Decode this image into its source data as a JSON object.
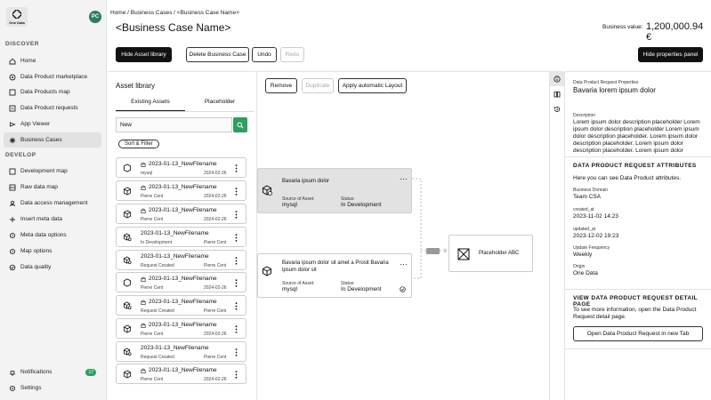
{
  "sidebar": {
    "logo_text": "One Data",
    "avatar_initials": "PC",
    "discover_label": "DISCOVER",
    "develop_label": "DEVELOP",
    "discover_items": [
      {
        "label": "Home",
        "icon": "home-icon"
      },
      {
        "label": "Data Product marketplace",
        "icon": "marketplace-icon"
      },
      {
        "label": "Data Products map",
        "icon": "map-icon"
      },
      {
        "label": "Data Product requests",
        "icon": "requests-icon"
      },
      {
        "label": "App Viewer",
        "icon": "app-viewer-icon"
      },
      {
        "label": "Business Cases",
        "icon": "business-cases-icon",
        "active": true
      }
    ],
    "develop_items": [
      {
        "label": "Development map",
        "icon": "development-map-icon"
      },
      {
        "label": "Raw data map",
        "icon": "raw-data-map-icon"
      },
      {
        "label": "Data access management",
        "icon": "access-icon"
      },
      {
        "label": "Insert meta data",
        "icon": "insert-meta-icon"
      },
      {
        "label": "Meta data options",
        "icon": "meta-options-icon"
      },
      {
        "label": "Map options",
        "icon": "map-options-icon"
      },
      {
        "label": "Data quality",
        "icon": "quality-icon"
      }
    ],
    "notifications_label": "Notifications",
    "notifications_count": "17",
    "settings_label": "Settings"
  },
  "header": {
    "breadcrumb": "Home / Business Cases / <Business Case Name>",
    "title": "<Business Case Name>",
    "business_value_label": "Business value:",
    "business_value": "1,200,000.94 €"
  },
  "toolbar": {
    "hide_asset_library": "Hide Asset library",
    "delete_business_case": "Delete Business Case",
    "undo": "Undo",
    "redo": "Redo",
    "hide_properties_panel": "Hide properties panel"
  },
  "asset_library": {
    "title": "Asset library",
    "tabs": [
      "Existing Assets",
      "Placeholder"
    ],
    "search_value": "New",
    "sort_filter": "Sort & Filter",
    "items": [
      {
        "name": "2023-01-13_NewFilename",
        "sub": "mysql",
        "right": "2024-02-26",
        "lock": true,
        "icon": "hexagon-icon"
      },
      {
        "name": "2023-01-13_NewFilename",
        "sub": "Pierre Cent",
        "right": "2024-02-26",
        "lock": true,
        "icon": "cube-icon"
      },
      {
        "name": "2023-01-13_NewFilename",
        "sub": "Pierre Cent",
        "right": "2024-02-26",
        "lock": true,
        "icon": "cube-icon"
      },
      {
        "name": "2023-01-13_NewFilename",
        "sub": "In Development",
        "right": "Pierre Cent",
        "lock": false,
        "icon": "data-product-icon"
      },
      {
        "name": "2023-01-13_NewFilename",
        "sub": "Request Created",
        "right": "Pierre Cent",
        "lock": false,
        "icon": "data-product-icon"
      },
      {
        "name": "2023-01-13_NewFilename",
        "sub": "Pierre Cent",
        "right": "2024-02-26",
        "lock": true,
        "icon": "hexagon-icon"
      },
      {
        "name": "2023-01-13_NewFilename",
        "sub": "Request Created",
        "right": "Pierre Cent",
        "lock": true,
        "icon": "data-product-icon"
      },
      {
        "name": "2023-01-13_NewFilename",
        "sub": "Pierre Cent",
        "right": "2024-02-26",
        "lock": true,
        "icon": "cube-icon"
      },
      {
        "name": "2023-01-13_NewFilename",
        "sub": "Request Created",
        "right": "Pierre Cent",
        "lock": false,
        "icon": "data-product-icon"
      },
      {
        "name": "2023-01-13_NewFilename",
        "sub": "Pierre Cent",
        "right": "2024-02-26",
        "lock": true,
        "icon": "cube-icon"
      }
    ]
  },
  "canvas": {
    "remove": "Remove",
    "duplicate": "Duplicate",
    "apply_layout": "Apply automatic Layout",
    "node1": {
      "title": "Bavaria ipsum dolor",
      "source_label": "Source of Asset:",
      "source": "mysql",
      "status_label": "Status:",
      "status": "In Development"
    },
    "node2": {
      "title": "Bavaria ipsum dolor sit amet a Prosit Bavaria ipsum dolor sit",
      "source_label": "Source of Asset:",
      "source": "mysql",
      "status_label": "Status:",
      "status": "In Development"
    },
    "node3": {
      "title": "Placeholder ABC"
    }
  },
  "properties": {
    "type_label": "Data Product Request Properties",
    "name": "Bavaria lorem ipsum dolor",
    "description_label": "Description",
    "description": "Lorem ipsum dolor description placeholder Lorem ipsum dolor description placeholder Lorem ipsum dolor description placeholder. Lorem ipsum dolor description placeholder. Lorem ipsum dolor description placeholder. Lorem ipsum dolor",
    "attributes_heading": "DATA PRODUCT REQUEST ATTRIBUTES",
    "attributes_intro": "Here you can see Data Product attributes.",
    "attributes": [
      {
        "label": "Business Domain",
        "value": "Team CSA"
      },
      {
        "label": "created_at",
        "value": "2023-11-02 14:23"
      },
      {
        "label": "updated_at",
        "value": "2023-12-02 19:23"
      },
      {
        "label": "Update Frequency",
        "value": "Weekly"
      },
      {
        "label": "Origin",
        "value": "One Data"
      }
    ],
    "detail_heading": "VIEW DATA PRODUCT REQUEST DETAIL PAGE",
    "detail_text": "To see more information, open the Data Product Request detail page.",
    "open_button": "Open Data Product Request in new Tab"
  }
}
